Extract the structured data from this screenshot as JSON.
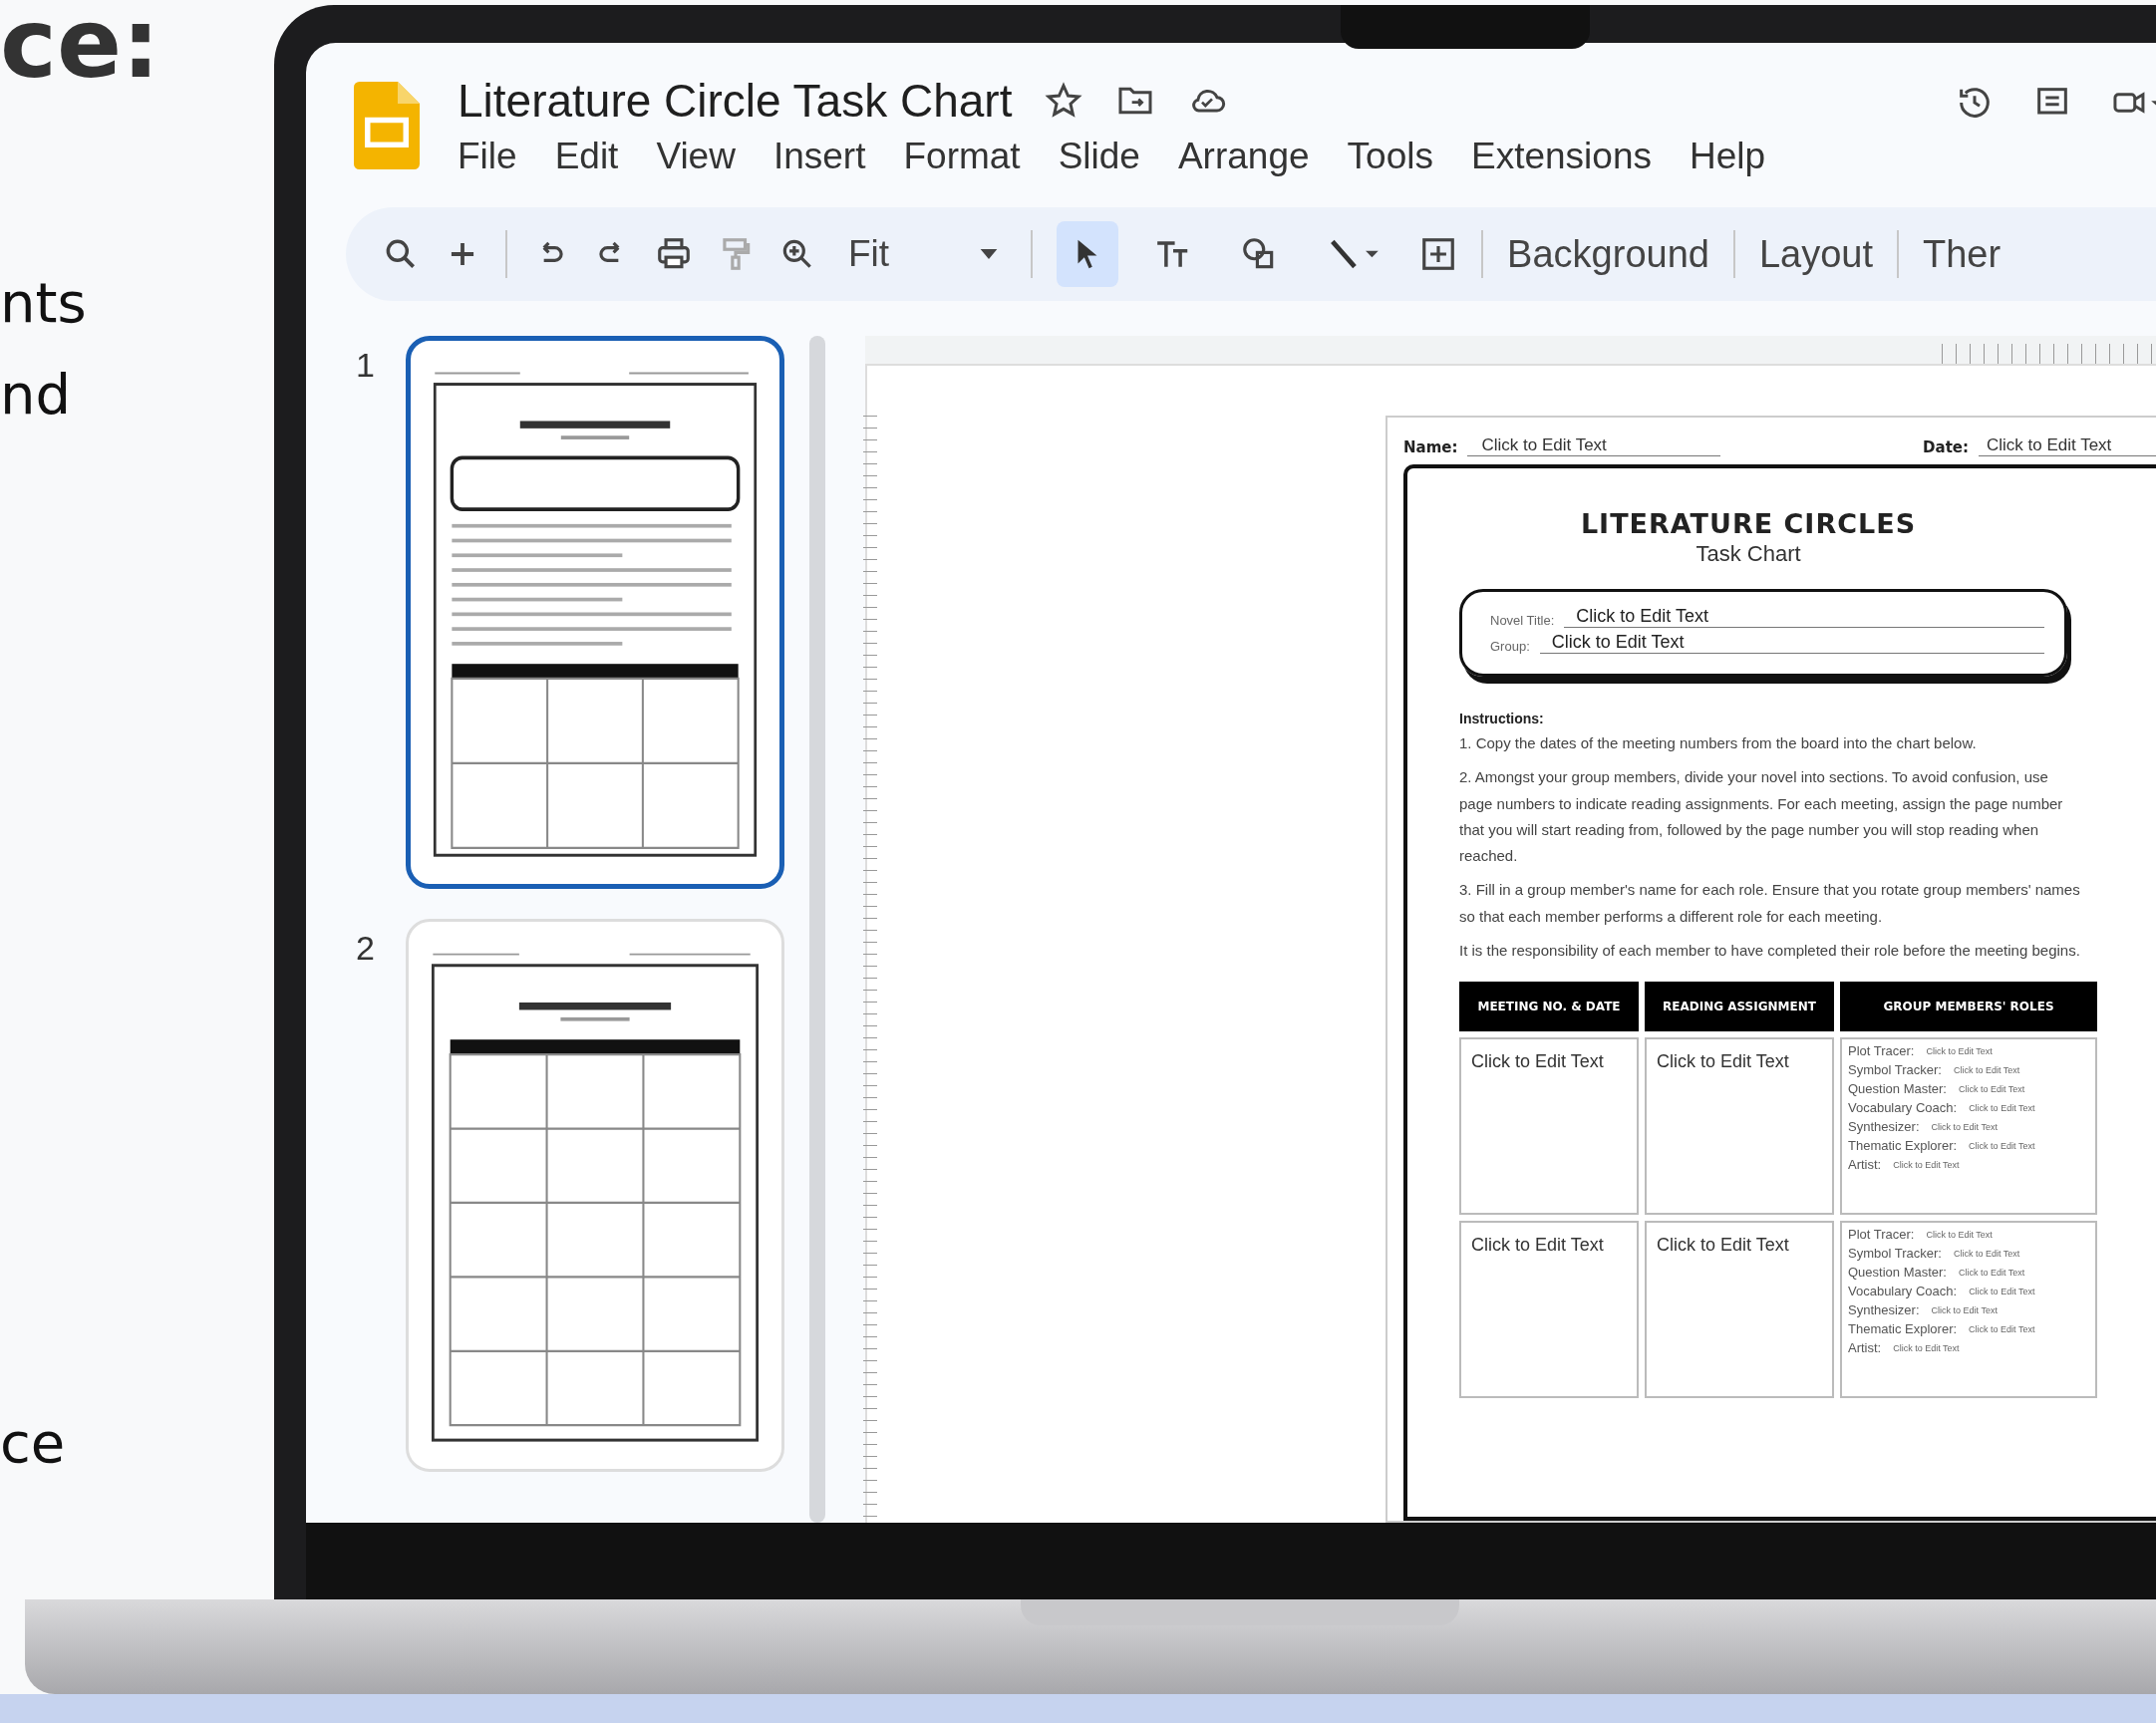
{
  "side_text": [
    "ce:",
    "nts",
    "nd",
    "ce"
  ],
  "document": {
    "title": "Literature Circle Task Chart"
  },
  "menu": [
    "File",
    "Edit",
    "View",
    "Insert",
    "Format",
    "Slide",
    "Arrange",
    "Tools",
    "Extensions",
    "Help"
  ],
  "toolbar": {
    "zoom": "Fit",
    "tools": [
      {
        "kind": "select",
        "selected": true
      },
      {
        "kind": "text-box",
        "selected": false
      },
      {
        "kind": "shape",
        "selected": false
      },
      {
        "kind": "line",
        "selected": false
      }
    ],
    "buttons": [
      "Background",
      "Layout",
      "Ther"
    ]
  },
  "slides": [
    {
      "number": "1",
      "selected": true,
      "kind": "instructions"
    },
    {
      "number": "2",
      "selected": false,
      "kind": "table"
    }
  ],
  "worksheet": {
    "name_label": "Name:",
    "name_value": "Click to Edit Text",
    "date_label": "Date:",
    "date_value": "Click to Edit Text",
    "heading": "LITERATURE CIRCLES",
    "subheading": "Task Chart",
    "fields": [
      {
        "label": "Novel Title:",
        "value": "Click to Edit Text"
      },
      {
        "label": "Group:",
        "value": "Click to Edit Text"
      }
    ],
    "instructions_heading": "Instructions:",
    "instructions": [
      "1. Copy the dates of the meeting numbers from the board into the chart below.",
      "2. Amongst your group members, divide your novel into sections. To avoid confusion, use page numbers to indicate reading assignments. For each meeting, assign the page number that you will start reading from, followed by the page number you will stop reading when reached.",
      "3. Fill in a group member's name for each role.  Ensure that you rotate group members' names so that each member performs a different role for each meeting.",
      "It is the responsibility of each member to have completed their role before the meeting begins."
    ],
    "table": {
      "columns": [
        "MEETING NO. & DATE",
        "READING ASSIGNMENT",
        "GROUP MEMBERS' ROLES"
      ],
      "rows": [
        {
          "meeting": "Click to Edit Text",
          "reading": "Click to Edit Text",
          "roles": [
            {
              "role": "Plot Tracer:",
              "value": "Click to Edit Text"
            },
            {
              "role": "Symbol Tracker:",
              "value": "Click to Edit Text"
            },
            {
              "role": "Question Master:",
              "value": "Click to Edit Text"
            },
            {
              "role": "Vocabulary Coach:",
              "value": "Click to Edit Text"
            },
            {
              "role": "Synthesizer:",
              "value": "Click to Edit Text"
            },
            {
              "role": "Thematic Explorer:",
              "value": "Click to Edit Text"
            },
            {
              "role": "Artist:",
              "value": "Click to Edit Text"
            }
          ]
        },
        {
          "meeting": "Click to Edit Text",
          "reading": "Click to Edit Text",
          "roles": [
            {
              "role": "Plot Tracer:",
              "value": "Click to Edit Text"
            },
            {
              "role": "Symbol Tracker:",
              "value": "Click to Edit Text"
            },
            {
              "role": "Question Master:",
              "value": "Click to Edit Text"
            },
            {
              "role": "Vocabulary Coach:",
              "value": "Click to Edit Text"
            },
            {
              "role": "Synthesizer:",
              "value": "Click to Edit Text"
            },
            {
              "role": "Thematic Explorer:",
              "value": "Click to Edit Text"
            },
            {
              "role": "Artist:",
              "value": "Click to Edit Text"
            }
          ]
        }
      ]
    }
  }
}
